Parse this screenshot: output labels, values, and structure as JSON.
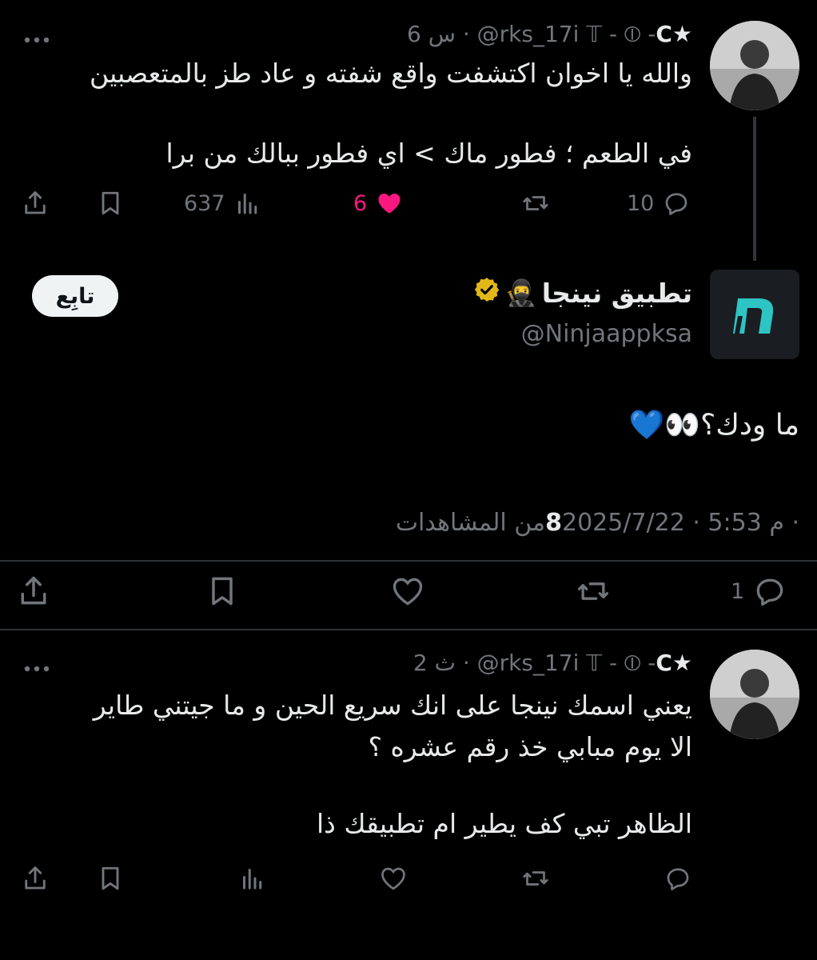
{
  "reply1": {
    "display_name": "C★",
    "handle_info": "6 س · @rks_17i 𝕋 - ⦶ - ",
    "text_line1": "والله يا اخوان اكتشفت واقع شفته و عاد طز بالمتعصبين",
    "text_line2": "في الطعم ؛ فطور ماك > اي فطور ببالك من برا",
    "replies_count": "10",
    "likes_count": "6",
    "views_count": "637"
  },
  "main": {
    "display_name": "تطبيق نينجا",
    "name_emoji": "🥷",
    "handle": "@Ninjaappksa",
    "follow_label": "تابِع",
    "text": "ما ودك؟👀💙",
    "meta_prefix": "2025/7/22 · 5:53 م · ",
    "views_count": "8",
    "views_label": " من المشاهدات",
    "replies_count": "1"
  },
  "reply2": {
    "display_name": "C★",
    "handle_info": "2 ث · @rks_17i 𝕋 - ⦶ - ",
    "text_line1": "يعني اسمك نينجا على انك سريع الحين و ما جيتني طاير",
    "text_line2": "الا يوم مبابي خذ رقم عشره ؟",
    "text_line3": "الظاهر تبي كف يطير ام تطبيقك ذا"
  },
  "colors": {
    "background": "#000000",
    "text": "#e7e9ea",
    "muted": "#71767b",
    "like_active": "#f91880",
    "verified_gold": "#e2b719",
    "divider": "#2f3336"
  },
  "icons": [
    "more-icon",
    "reply-icon",
    "retweet-icon",
    "like-icon",
    "views-icon",
    "bookmark-icon",
    "share-icon",
    "verified-icon"
  ]
}
